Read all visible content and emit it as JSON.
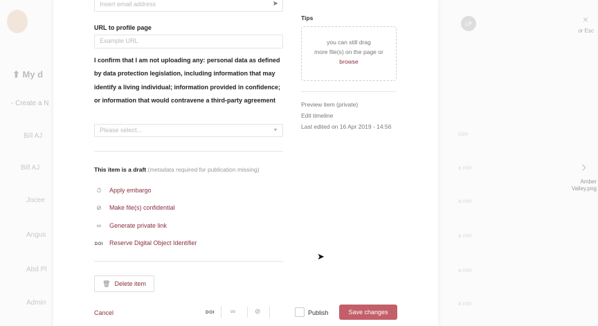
{
  "background": {
    "title": "My d",
    "subtitle": "- Create a N",
    "avatar_initials": "LP",
    "rows": [
      "Bill AJ",
      "Jocee",
      "Angus",
      "Abd Pl",
      "Admin"
    ],
    "right_col": [
      "size",
      "a min",
      "a min",
      "a min",
      "a min",
      "a min"
    ]
  },
  "close": {
    "icon": "×",
    "label": "or Esc"
  },
  "next": {
    "icon": "›",
    "label": "Amber Valley.png"
  },
  "form": {
    "email_placeholder": "Insert email address",
    "url_label": "URL to profile page",
    "url_placeholder": "Example URL",
    "confirm_text": "I confirm that I am not uploading any: personal data as defined by data protection legislation, including information that may identify a living individual; information provided in confidence; or information that would contravene a third-party agreement",
    "select_placeholder": "Please select..."
  },
  "draft": {
    "bold": "This item is a draft",
    "muted": "(metadata required for publication missing)"
  },
  "actions": {
    "embargo": "Apply embargo",
    "confidential": "Make file(s) confidential",
    "private_link": "Generate private link",
    "doi_badge": "DOI",
    "doi": "Reserve Digital Object Identifier",
    "delete": "Delete item"
  },
  "tips": {
    "title": "Tips",
    "line1": "you can still drag",
    "line2": "more file(s) on the page or",
    "browse": "browse"
  },
  "side": {
    "preview": "Preview item (private)",
    "timeline": "Edit timeline",
    "last_edited": "Last edited on 16 Apr 2019 - 14:56"
  },
  "footer": {
    "cancel": "Cancel",
    "doi": "DOI",
    "publish": "Publish",
    "save": "Save changes"
  }
}
